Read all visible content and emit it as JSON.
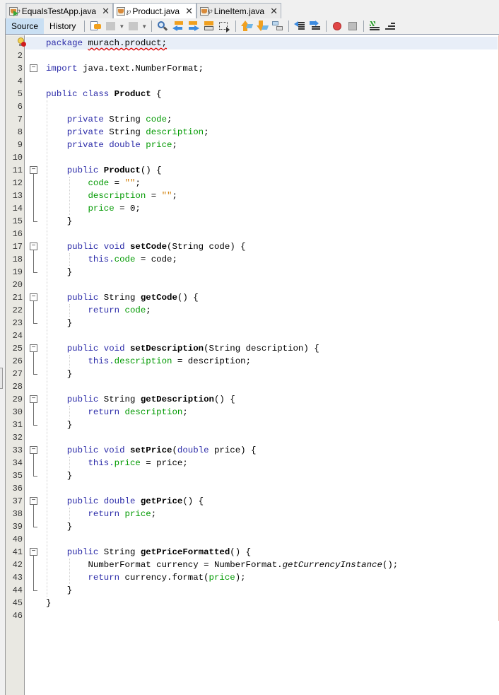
{
  "tabs": [
    {
      "label": "EqualsTestApp.java",
      "icon": "java-main-class-icon",
      "active": false
    },
    {
      "label": "Product.java",
      "icon": "java-class-icon",
      "active": true
    },
    {
      "label": "LineItem.java",
      "icon": "java-class-icon",
      "active": false
    }
  ],
  "toolbar": {
    "source_label": "Source",
    "history_label": "History",
    "icons": [
      "last-edit-icon",
      "back-icon",
      "forward-icon",
      "find-icon",
      "find-previous-icon",
      "find-next-icon",
      "toggle-highlight-icon",
      "toggle-rect-select-icon",
      "previous-bookmark-icon",
      "next-bookmark-icon",
      "toggle-bookmark-icon",
      "shift-left-icon",
      "shift-right-icon",
      "start-macro-icon",
      "stop-macro-icon",
      "comment-icon",
      "uncomment-icon"
    ]
  },
  "editor": {
    "file": "Product.java",
    "current_line": 1,
    "line_numbers": [
      "",
      "2",
      "3",
      "4",
      "5",
      "6",
      "7",
      "8",
      "9",
      "10",
      "11",
      "12",
      "13",
      "14",
      "15",
      "16",
      "17",
      "18",
      "19",
      "20",
      "21",
      "22",
      "23",
      "24",
      "25",
      "26",
      "27",
      "28",
      "29",
      "30",
      "31",
      "32",
      "33",
      "34",
      "35",
      "36",
      "37",
      "38",
      "39",
      "40",
      "41",
      "42",
      "43",
      "44",
      "45",
      "46"
    ],
    "lines": [
      [
        {
          "t": "package ",
          "c": "kw"
        },
        {
          "t": "murach.product;",
          "c": "err"
        }
      ],
      [],
      [
        {
          "t": "import ",
          "c": "kw"
        },
        {
          "t": "java.text.NumberFormat;",
          "c": ""
        }
      ],
      [],
      [
        {
          "t": "public class ",
          "c": "kw"
        },
        {
          "t": "Product",
          "c": "b"
        },
        {
          "t": " {",
          "c": ""
        }
      ],
      [],
      [
        {
          "t": "    private ",
          "c": "kw"
        },
        {
          "t": "String ",
          "c": ""
        },
        {
          "t": "code",
          "c": "fld"
        },
        {
          "t": ";",
          "c": ""
        }
      ],
      [
        {
          "t": "    private ",
          "c": "kw"
        },
        {
          "t": "String ",
          "c": ""
        },
        {
          "t": "description",
          "c": "fld"
        },
        {
          "t": ";",
          "c": ""
        }
      ],
      [
        {
          "t": "    private double ",
          "c": "kw"
        },
        {
          "t": "price",
          "c": "fld"
        },
        {
          "t": ";",
          "c": ""
        }
      ],
      [],
      [
        {
          "t": "    public ",
          "c": "kw"
        },
        {
          "t": "Product",
          "c": "b"
        },
        {
          "t": "() {",
          "c": ""
        }
      ],
      [
        {
          "t": "        ",
          "c": ""
        },
        {
          "t": "code",
          "c": "fld"
        },
        {
          "t": " = ",
          "c": ""
        },
        {
          "t": "\"\"",
          "c": "str"
        },
        {
          "t": ";",
          "c": ""
        }
      ],
      [
        {
          "t": "        ",
          "c": ""
        },
        {
          "t": "description",
          "c": "fld"
        },
        {
          "t": " = ",
          "c": ""
        },
        {
          "t": "\"\"",
          "c": "str"
        },
        {
          "t": ";",
          "c": ""
        }
      ],
      [
        {
          "t": "        ",
          "c": ""
        },
        {
          "t": "price",
          "c": "fld"
        },
        {
          "t": " = 0;",
          "c": ""
        }
      ],
      [
        {
          "t": "    }",
          "c": ""
        }
      ],
      [],
      [
        {
          "t": "    public void ",
          "c": "kw"
        },
        {
          "t": "setCode",
          "c": "b"
        },
        {
          "t": "(String code) {",
          "c": ""
        }
      ],
      [
        {
          "t": "        this.",
          "c": "kw"
        },
        {
          "t": "code",
          "c": "fld"
        },
        {
          "t": " = code;",
          "c": ""
        }
      ],
      [
        {
          "t": "    }",
          "c": ""
        }
      ],
      [],
      [
        {
          "t": "    public ",
          "c": "kw"
        },
        {
          "t": "String ",
          "c": ""
        },
        {
          "t": "getCode",
          "c": "b"
        },
        {
          "t": "() {",
          "c": ""
        }
      ],
      [
        {
          "t": "        return ",
          "c": "kw"
        },
        {
          "t": "code",
          "c": "fld"
        },
        {
          "t": ";",
          "c": ""
        }
      ],
      [
        {
          "t": "    }",
          "c": ""
        }
      ],
      [],
      [
        {
          "t": "    public void ",
          "c": "kw"
        },
        {
          "t": "setDescription",
          "c": "b"
        },
        {
          "t": "(String description) {",
          "c": ""
        }
      ],
      [
        {
          "t": "        this.",
          "c": "kw"
        },
        {
          "t": "description",
          "c": "fld"
        },
        {
          "t": " = description;",
          "c": ""
        }
      ],
      [
        {
          "t": "    }",
          "c": ""
        }
      ],
      [],
      [
        {
          "t": "    public ",
          "c": "kw"
        },
        {
          "t": "String ",
          "c": ""
        },
        {
          "t": "getDescription",
          "c": "b"
        },
        {
          "t": "() {",
          "c": ""
        }
      ],
      [
        {
          "t": "        return ",
          "c": "kw"
        },
        {
          "t": "description",
          "c": "fld"
        },
        {
          "t": ";",
          "c": ""
        }
      ],
      [
        {
          "t": "    }",
          "c": ""
        }
      ],
      [],
      [
        {
          "t": "    public void ",
          "c": "kw"
        },
        {
          "t": "setPrice",
          "c": "b"
        },
        {
          "t": "(",
          "c": ""
        },
        {
          "t": "double ",
          "c": "kw"
        },
        {
          "t": "price) {",
          "c": ""
        }
      ],
      [
        {
          "t": "        this.",
          "c": "kw"
        },
        {
          "t": "price",
          "c": "fld"
        },
        {
          "t": " = price;",
          "c": ""
        }
      ],
      [
        {
          "t": "    }",
          "c": ""
        }
      ],
      [],
      [
        {
          "t": "    public double ",
          "c": "kw"
        },
        {
          "t": "getPrice",
          "c": "b"
        },
        {
          "t": "() {",
          "c": ""
        }
      ],
      [
        {
          "t": "        return ",
          "c": "kw"
        },
        {
          "t": "price",
          "c": "fld"
        },
        {
          "t": ";",
          "c": ""
        }
      ],
      [
        {
          "t": "    }",
          "c": ""
        }
      ],
      [],
      [
        {
          "t": "    public ",
          "c": "kw"
        },
        {
          "t": "String ",
          "c": ""
        },
        {
          "t": "getPriceFormatted",
          "c": "b"
        },
        {
          "t": "() {",
          "c": ""
        }
      ],
      [
        {
          "t": "        NumberFormat currency = NumberFormat.",
          "c": ""
        },
        {
          "t": "getCurrencyInstance",
          "c": "it"
        },
        {
          "t": "();",
          "c": ""
        }
      ],
      [
        {
          "t": "        return ",
          "c": "kw"
        },
        {
          "t": "currency.format(",
          "c": ""
        },
        {
          "t": "price",
          "c": "fld"
        },
        {
          "t": ");",
          "c": ""
        }
      ],
      [
        {
          "t": "    }",
          "c": ""
        }
      ],
      [
        {
          "t": "}",
          "c": ""
        }
      ],
      []
    ],
    "folds": [
      {
        "start": 3,
        "end": 3
      },
      {
        "start": 11,
        "end": 15
      },
      {
        "start": 17,
        "end": 19
      },
      {
        "start": 21,
        "end": 23
      },
      {
        "start": 25,
        "end": 27
      },
      {
        "start": 29,
        "end": 31
      },
      {
        "start": 33,
        "end": 35
      },
      {
        "start": 37,
        "end": 39
      },
      {
        "start": 41,
        "end": 44
      }
    ],
    "gutter_annotation": {
      "line": 1,
      "icon": "error-hint-bulb-icon"
    }
  }
}
